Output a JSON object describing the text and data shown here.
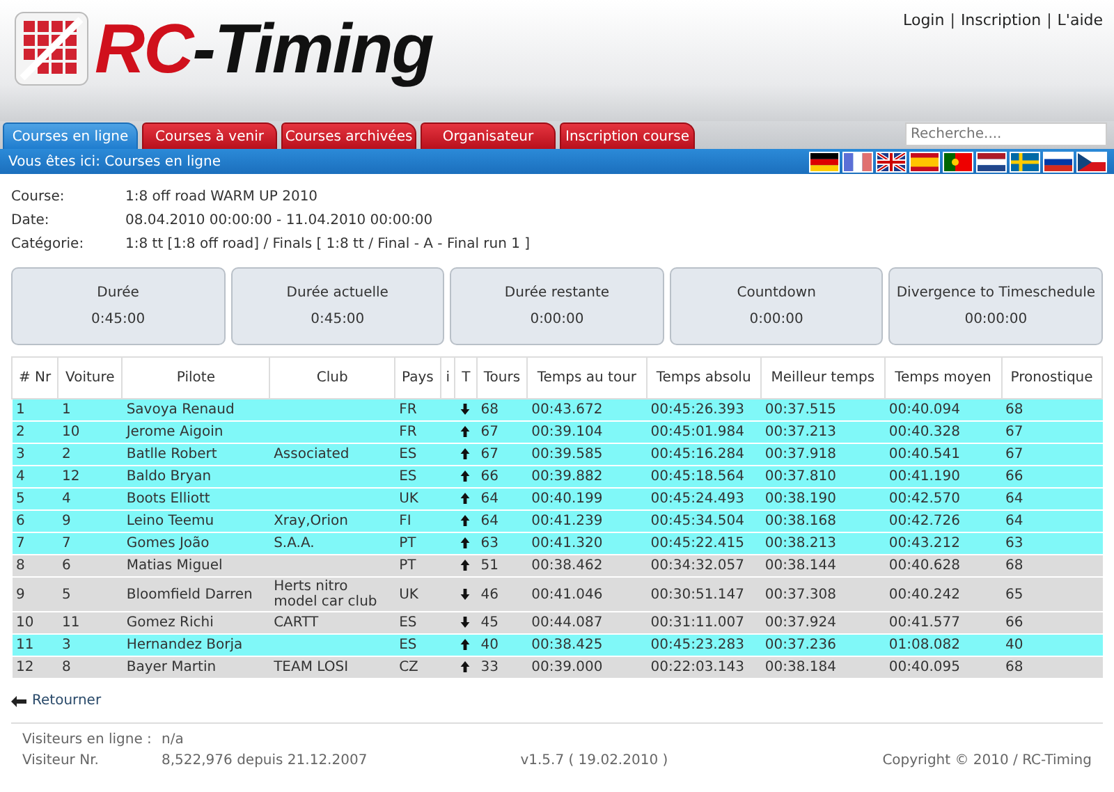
{
  "header": {
    "logo": [
      "RC",
      "-Timing"
    ],
    "links": [
      "Login",
      "Inscription",
      "L'aide"
    ],
    "separator": "|"
  },
  "tabs": [
    {
      "label": "Courses en ligne",
      "selected": true
    },
    {
      "label": "Courses à venir",
      "selected": false
    },
    {
      "label": "Courses archivées",
      "selected": false
    },
    {
      "label": "Organisateur",
      "selected": false
    },
    {
      "label": "Inscription course",
      "selected": false
    }
  ],
  "search": {
    "placeholder": "Recherche...."
  },
  "breadcrumb": "Vous êtes ici: Courses en ligne",
  "languages": [
    {
      "kind": "de"
    },
    {
      "kind": "fr"
    },
    {
      "kind": "gb"
    },
    {
      "kind": "es"
    },
    {
      "kind": "pt"
    },
    {
      "kind": "nl"
    },
    {
      "kind": "se"
    },
    {
      "kind": "ru"
    },
    {
      "kind": "cz"
    }
  ],
  "info": [
    {
      "label": "Course:",
      "value": "1:8 off road WARM UP 2010"
    },
    {
      "label": "Date:",
      "value": "08.04.2010 00:00:00 - 11.04.2010 00:00:00"
    },
    {
      "label": "Catégorie:",
      "value": "1:8 tt [1:8 off road] / Finals [ 1:8 tt / Final - A - Final run 1 ]"
    }
  ],
  "timers": [
    {
      "label": "Durée",
      "value": "0:45:00"
    },
    {
      "label": "Durée actuelle",
      "value": "0:45:00"
    },
    {
      "label": "Durée restante",
      "value": "0:00:00"
    },
    {
      "label": "Countdown",
      "value": "0:00:00"
    },
    {
      "label": "Divergence to Timeschedule",
      "value": "00:00:00"
    }
  ],
  "table": {
    "columns": [
      "# Nr",
      "Voiture",
      "Pilote",
      "Club",
      "Pays",
      "i",
      "T",
      "Tours",
      "Temps au tour",
      "Temps absolu",
      "Meilleur temps",
      "Temps moyen",
      "Pronostique"
    ],
    "rows": [
      {
        "highlighted": true,
        "kind": "down",
        "cells": [
          "1",
          "1",
          "Savoya Renaud",
          "",
          "FR",
          "",
          "",
          "68",
          "00:43.672",
          "00:45:26.393",
          "00:37.515",
          "00:40.094",
          "68"
        ]
      },
      {
        "highlighted": true,
        "kind": "up",
        "cells": [
          "2",
          "10",
          "Jerome Aigoin",
          "",
          "FR",
          "",
          "",
          "67",
          "00:39.104",
          "00:45:01.984",
          "00:37.213",
          "00:40.328",
          "67"
        ]
      },
      {
        "highlighted": true,
        "kind": "up",
        "cells": [
          "3",
          "2",
          "Batlle Robert",
          "Associated",
          "ES",
          "",
          "",
          "67",
          "00:39.585",
          "00:45:16.284",
          "00:37.918",
          "00:40.541",
          "67"
        ]
      },
      {
        "highlighted": true,
        "kind": "up",
        "cells": [
          "4",
          "12",
          "Baldo Bryan",
          "",
          "ES",
          "",
          "",
          "66",
          "00:39.882",
          "00:45:18.564",
          "00:37.810",
          "00:41.190",
          "66"
        ]
      },
      {
        "highlighted": true,
        "kind": "up",
        "cells": [
          "5",
          "4",
          "Boots Elliott",
          "",
          "UK",
          "",
          "",
          "64",
          "00:40.199",
          "00:45:24.493",
          "00:38.190",
          "00:42.570",
          "64"
        ]
      },
      {
        "highlighted": true,
        "kind": "up",
        "cells": [
          "6",
          "9",
          "Leino Teemu",
          "Xray,Orion",
          "FI",
          "",
          "",
          "64",
          "00:41.239",
          "00:45:34.504",
          "00:38.168",
          "00:42.726",
          "64"
        ]
      },
      {
        "highlighted": true,
        "kind": "up",
        "cells": [
          "7",
          "7",
          "Gomes João",
          "S.A.A.",
          "PT",
          "",
          "",
          "63",
          "00:41.320",
          "00:45:22.415",
          "00:38.213",
          "00:43.212",
          "63"
        ]
      },
      {
        "highlighted": false,
        "kind": "up",
        "cells": [
          "8",
          "6",
          "Matias Miguel",
          "",
          "PT",
          "",
          "",
          "51",
          "00:38.462",
          "00:34:32.057",
          "00:38.144",
          "00:40.628",
          "68"
        ]
      },
      {
        "highlighted": false,
        "kind": "down",
        "cells": [
          "9",
          "5",
          "Bloomfield Darren",
          "Herts nitro model car club",
          "UK",
          "",
          "",
          "46",
          "00:41.046",
          "00:30:51.147",
          "00:37.308",
          "00:40.242",
          "65"
        ]
      },
      {
        "highlighted": false,
        "kind": "down",
        "cells": [
          "10",
          "11",
          "Gomez Richi",
          "CARTT",
          "ES",
          "",
          "",
          "45",
          "00:44.087",
          "00:31:11.007",
          "00:37.924",
          "00:41.577",
          "66"
        ]
      },
      {
        "highlighted": true,
        "kind": "up",
        "cells": [
          "11",
          "3",
          "Hernandez Borja",
          "",
          "ES",
          "",
          "",
          "40",
          "00:38.425",
          "00:45:23.283",
          "00:37.236",
          "01:08.082",
          "40"
        ]
      },
      {
        "highlighted": false,
        "kind": "up",
        "cells": [
          "12",
          "8",
          "Bayer Martin",
          "TEAM LOSI",
          "CZ",
          "",
          "",
          "33",
          "00:39.000",
          "00:22:03.143",
          "00:38.184",
          "00:40.095",
          "68"
        ]
      }
    ]
  },
  "back_link": "Retourner",
  "footer": {
    "visitors_label": "Visiteurs en ligne :",
    "visitors_value": "n/a",
    "visitor_nr_label": "Visiteur Nr.",
    "visitor_nr_value": "8,522,976 depuis 21.12.2007",
    "version": "v1.5.7 ( 19.02.2010 )",
    "copyright": "Copyright © 2010 / RC-Timing"
  }
}
